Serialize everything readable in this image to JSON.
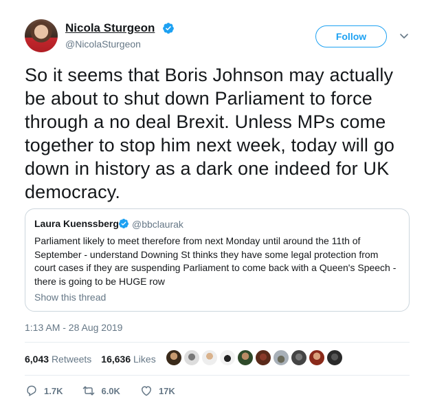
{
  "author": {
    "name": "Nicola Sturgeon",
    "handle": "@NicolaSturgeon",
    "avatar_icon": "avatar"
  },
  "follow_label": "Follow",
  "tweet_text": "So it seems that Boris Johnson may actually be about to shut down Parliament to force through a no deal Brexit. Unless MPs come together to stop him next week, today will go down in history as a dark one indeed for UK democracy.",
  "quoted": {
    "name": "Laura Kuenssberg",
    "handle": "@bbclaurak",
    "text": "Parliament likely to meet therefore from next Monday until around the 11th of September - understand Downing St thinks they have some legal protection from court cases if they are suspending Parliament to come back with a Queen's Speech - there is going to be  HUGE row",
    "show_thread": "Show this thread"
  },
  "timestamp": "1:13 AM - 28 Aug 2019",
  "stats": {
    "retweets_count": "6,043",
    "retweets_label": "Retweets",
    "likes_count": "16,636",
    "likes_label": "Likes"
  },
  "actions": {
    "replies": "1.7K",
    "retweets": "6.0K",
    "likes": "17K"
  },
  "colors": {
    "accent": "#1da1f2",
    "muted": "#657786",
    "text": "#14171a"
  }
}
